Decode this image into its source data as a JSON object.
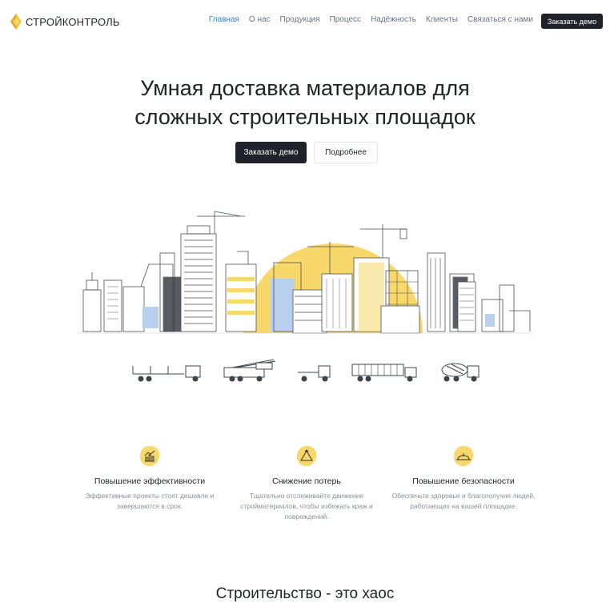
{
  "brand": {
    "name": "СТРОЙКОНТРОЛЬ",
    "accent": "#f5c542"
  },
  "nav": {
    "items": [
      {
        "label": "Главная",
        "active": true
      },
      {
        "label": "О нас",
        "active": false
      },
      {
        "label": "Продукция",
        "active": false
      },
      {
        "label": "Процесс",
        "active": false
      },
      {
        "label": "Надёжность",
        "active": false
      },
      {
        "label": "Клиенты",
        "active": false
      },
      {
        "label": "Связаться с нами",
        "active": false
      }
    ],
    "cta": "Заказать демо"
  },
  "hero": {
    "title_line1": "Умная доставка материалов для",
    "title_line2": "сложных строительных площадок",
    "primary_button": "Заказать демо",
    "secondary_button": "Подробнее"
  },
  "features": [
    {
      "icon": "chart-icon",
      "title": "Повышение эффективности",
      "text": "Эффективные проекты стоят дешевле и завершаются в срок."
    },
    {
      "icon": "recycle-icon",
      "title": "Снижение потерь",
      "text": "Тщательно отслеживайте движение стройматериалов, чтобы избежать краж и повреждений."
    },
    {
      "icon": "hardhat-icon",
      "title": "Повышение безопасности",
      "text": "Обеспечьте здоровье и благополучие людей, работающих на вашей площадке."
    }
  ],
  "section": {
    "title": "Строительство - это хаос"
  },
  "colors": {
    "dark": "#1f2329",
    "link_active": "#3b82c4",
    "muted": "#8a9098",
    "yellow": "#f8d86a",
    "blue_window": "#b8d0ee"
  }
}
